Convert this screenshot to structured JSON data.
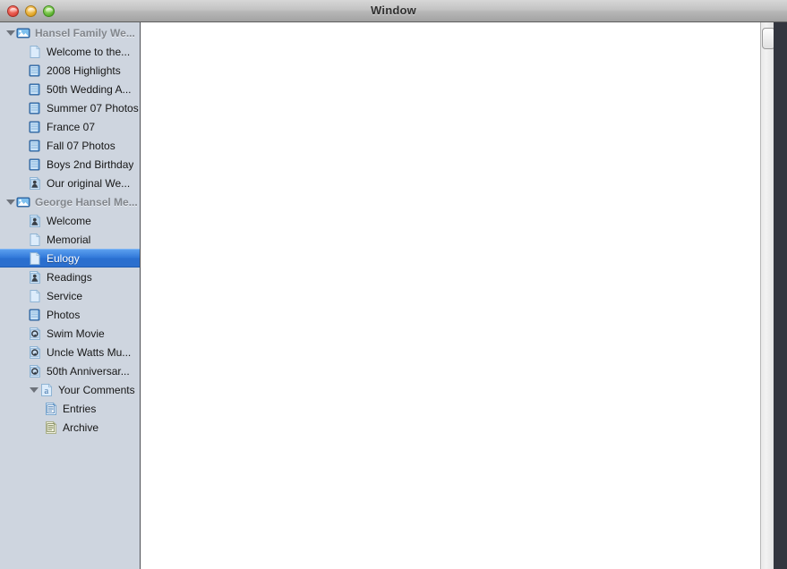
{
  "window": {
    "title": "Window",
    "traffic_lights": [
      {
        "name": "close",
        "color": "#e0483d"
      },
      {
        "name": "minimize",
        "color": "#e0a423"
      },
      {
        "name": "zoom",
        "color": "#5cb22f"
      }
    ]
  },
  "colors": {
    "sidebar_background": "#ced5df",
    "selection_blue": "#2f77d8",
    "group_text": "#82868c",
    "row_text": "#161616",
    "divider": "#4d4f55",
    "main_background": "#ffffff"
  },
  "sidebar": {
    "groups": [
      {
        "header": {
          "label": "Hansel Family We...",
          "icon": "site-cloud-icon",
          "expanded": true,
          "disclosure": "disclosure-triangle-open"
        },
        "items": [
          {
            "label": "Welcome to the...",
            "icon": "blank-page-icon",
            "selected": false,
            "indent": 1
          },
          {
            "label": "2008 Highlights",
            "icon": "photo-album-icon",
            "selected": false,
            "indent": 1
          },
          {
            "label": "50th Wedding A...",
            "icon": "photo-album-icon",
            "selected": false,
            "indent": 1
          },
          {
            "label": "Summer 07 Photos",
            "icon": "photo-album-icon",
            "selected": false,
            "indent": 1
          },
          {
            "label": "France 07",
            "icon": "photo-album-icon",
            "selected": false,
            "indent": 1
          },
          {
            "label": "Fall 07 Photos",
            "icon": "photo-album-icon",
            "selected": false,
            "indent": 1
          },
          {
            "label": "Boys 2nd Birthday",
            "icon": "photo-album-icon",
            "selected": false,
            "indent": 1
          },
          {
            "label": "Our original We...",
            "icon": "profile-page-icon",
            "selected": false,
            "indent": 1
          }
        ]
      },
      {
        "header": {
          "label": "George Hansel Me...",
          "icon": "site-cloud-icon",
          "expanded": true,
          "disclosure": "disclosure-triangle-open"
        },
        "items": [
          {
            "label": "Welcome",
            "icon": "profile-page-icon",
            "selected": false,
            "indent": 1
          },
          {
            "label": "Memorial",
            "icon": "blank-page-icon",
            "selected": false,
            "indent": 1
          },
          {
            "label": "Eulogy",
            "icon": "blank-page-icon",
            "selected": true,
            "indent": 1
          },
          {
            "label": "Readings",
            "icon": "profile-page-icon",
            "selected": false,
            "indent": 1
          },
          {
            "label": "Service",
            "icon": "blank-page-icon",
            "selected": false,
            "indent": 1
          },
          {
            "label": "Photos",
            "icon": "photo-album-icon",
            "selected": false,
            "indent": 1
          },
          {
            "label": "Swim Movie",
            "icon": "movie-page-icon",
            "selected": false,
            "indent": 1
          },
          {
            "label": "Uncle Watts Mu...",
            "icon": "movie-page-icon",
            "selected": false,
            "indent": 1
          },
          {
            "label": "50th Anniversar...",
            "icon": "movie-page-icon",
            "selected": false,
            "indent": 1
          },
          {
            "label": "Your Comments",
            "icon": "blog-page-icon",
            "selected": false,
            "indent": 2,
            "expanded": true,
            "disclosure": "disclosure-triangle-open"
          },
          {
            "label": "Entries",
            "icon": "blog-entries-icon",
            "selected": false,
            "indent": 3
          },
          {
            "label": "Archive",
            "icon": "blog-archive-icon",
            "selected": false,
            "indent": 3
          }
        ]
      }
    ]
  },
  "main": {
    "content": ""
  },
  "scrollbar": {
    "name": "vertical-scrollbar",
    "up_button": "scroll-up-button"
  }
}
